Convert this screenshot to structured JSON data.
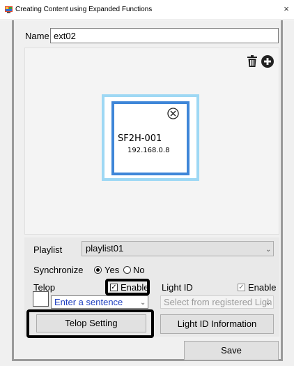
{
  "window": {
    "title": "Creating Content using Expanded Functions",
    "close_glyph": "×",
    "icon": "app-icon"
  },
  "name": {
    "label": "Name",
    "value": "ext02"
  },
  "canvas": {
    "toolbar_icons": [
      "trash-icon",
      "add-circle-icon"
    ],
    "device": {
      "name": "SF2H-001",
      "ip": "192.168.0.8",
      "remove_icon": "circle-x-icon"
    }
  },
  "playlist": {
    "label": "Playlist",
    "selected": "playlist01"
  },
  "synchronize": {
    "label": "Synchronize",
    "options": [
      "Yes",
      "No"
    ],
    "selected": "Yes"
  },
  "telop": {
    "label": "Telop",
    "enable_label": "Enable",
    "enabled": true,
    "sentence_placeholder": "Enter a sentence",
    "setting_button": "Telop Setting"
  },
  "light_id": {
    "label": "Light ID",
    "enable_label": "Enable",
    "enabled": true,
    "select_placeholder": "Select from registered Ligh",
    "info_button": "Light ID Information"
  },
  "footer": {
    "save_button": "Save"
  },
  "colors": {
    "accent_blue": "#3e86d8",
    "light_blue": "#9ed8f4",
    "sentence_text": "#1f3fbf",
    "highlight": "#000000"
  }
}
